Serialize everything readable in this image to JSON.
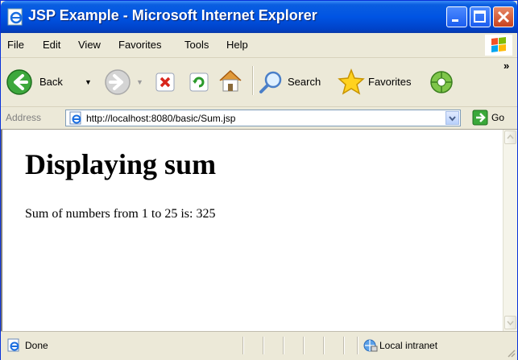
{
  "window": {
    "title": "JSP Example - Microsoft Internet Explorer"
  },
  "menu": {
    "items": [
      "File",
      "Edit",
      "View",
      "Favorites",
      "Tools",
      "Help"
    ]
  },
  "toolbar": {
    "back_label": "Back",
    "search_label": "Search",
    "favorites_label": "Favorites",
    "overflow": "»"
  },
  "address": {
    "label": "Address",
    "url": "http://localhost:8080/basic/Sum.jsp",
    "go_label": "Go"
  },
  "page": {
    "heading": "Displaying sum",
    "text": "Sum of numbers from 1 to 25 is: 325"
  },
  "status": {
    "text": "Done",
    "zone": "Local intranet"
  }
}
